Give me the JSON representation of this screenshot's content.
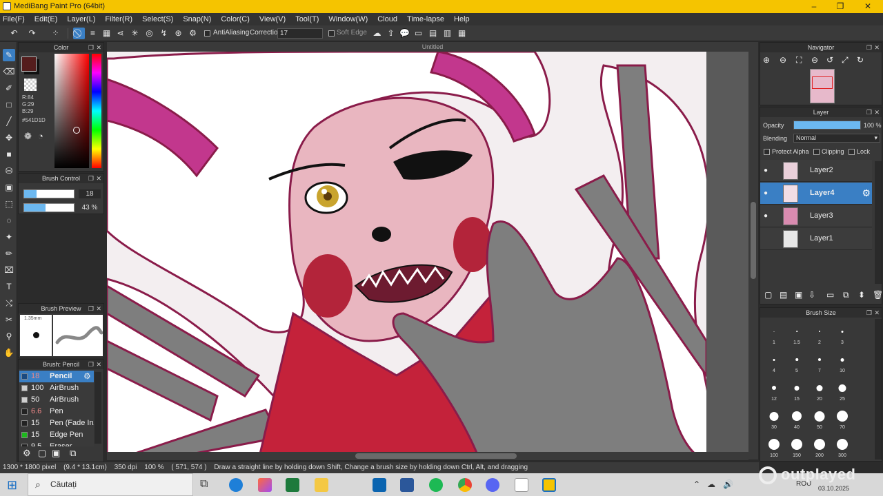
{
  "titlebar": {
    "title": "MediBang Paint Pro (64bit)",
    "min": "–",
    "max": "❐",
    "close": "✕"
  },
  "menu": [
    "File(F)",
    "Edit(E)",
    "Layer(L)",
    "Filter(R)",
    "Select(S)",
    "Snap(N)",
    "Color(C)",
    "View(V)",
    "Tool(T)",
    "Window(W)",
    "Cloud",
    "Time-lapse",
    "Help"
  ],
  "toolbar": {
    "antialiasing_label": "AntiAliasing",
    "correction_label": "Correction",
    "correction_value": "17",
    "soft_edge_label": "Soft Edge"
  },
  "color_panel": {
    "title": "Color",
    "r": "R:84",
    "g": "G:29",
    "b": "B:29",
    "hex": "#541D1D",
    "current_color": "#541D1D"
  },
  "brush_control": {
    "title": "Brush Control",
    "size_value": "18",
    "opacity_value": "43 %",
    "size_fraction": 0.25,
    "opacity_fraction": 0.43
  },
  "brush_preview": {
    "title": "Brush Preview",
    "size_label": "1.35mm"
  },
  "brush_list": {
    "title": "Brush: Pencil",
    "items": [
      {
        "size": "18",
        "name": "Pencil",
        "color": "#1a4a80"
      },
      {
        "size": "100",
        "name": "AirBrush",
        "color": "#cfcfcf"
      },
      {
        "size": "50",
        "name": "AirBrush",
        "color": "#cfcfcf"
      },
      {
        "size": "6.6",
        "name": "Pen",
        "color": "#222222"
      },
      {
        "size": "15",
        "name": "Pen (Fade In/",
        "color": "#222222"
      },
      {
        "size": "15",
        "name": "Edge Pen",
        "color": "#1db81d"
      },
      {
        "size": "9.5",
        "name": "Eraser",
        "color": "#222222"
      }
    ]
  },
  "document": {
    "title": "Untitled"
  },
  "navigator": {
    "title": "Navigator"
  },
  "layer_panel": {
    "title": "Layer",
    "opacity_label": "Opacity",
    "opacity_value": "100 %",
    "opacity_fraction": 1.0,
    "blending_label": "Blending",
    "blending_value": "Normal",
    "protect_alpha": "Protect Alpha",
    "clipping": "Clipping",
    "lock": "Lock",
    "layers": [
      {
        "name": "Layer2",
        "visible": true
      },
      {
        "name": "Layer4",
        "visible": true
      },
      {
        "name": "Layer3",
        "visible": true
      },
      {
        "name": "Layer1",
        "visible": false
      }
    ]
  },
  "brush_size_panel": {
    "title": "Brush Size",
    "sizes": [
      "1",
      "1.5",
      "2",
      "3",
      "4",
      "5",
      "7",
      "10",
      "12",
      "15",
      "20",
      "25",
      "30",
      "40",
      "50",
      "70",
      "100",
      "150",
      "200",
      "300"
    ]
  },
  "status": {
    "dimensions": "1300 * 1800 pixel",
    "physical": "(9.4 * 13.1cm)",
    "dpi": "350 dpi",
    "zoom": "100 %",
    "coords": "( 571, 574 )",
    "hint": "Draw a straight line by holding down Shift, Change a brush size by holding down Ctrl, Alt, and dragging"
  },
  "taskbar": {
    "search_placeholder": "Căutați",
    "lang": "ROU",
    "date": "03.10.2025"
  },
  "watermark": "outplayed"
}
